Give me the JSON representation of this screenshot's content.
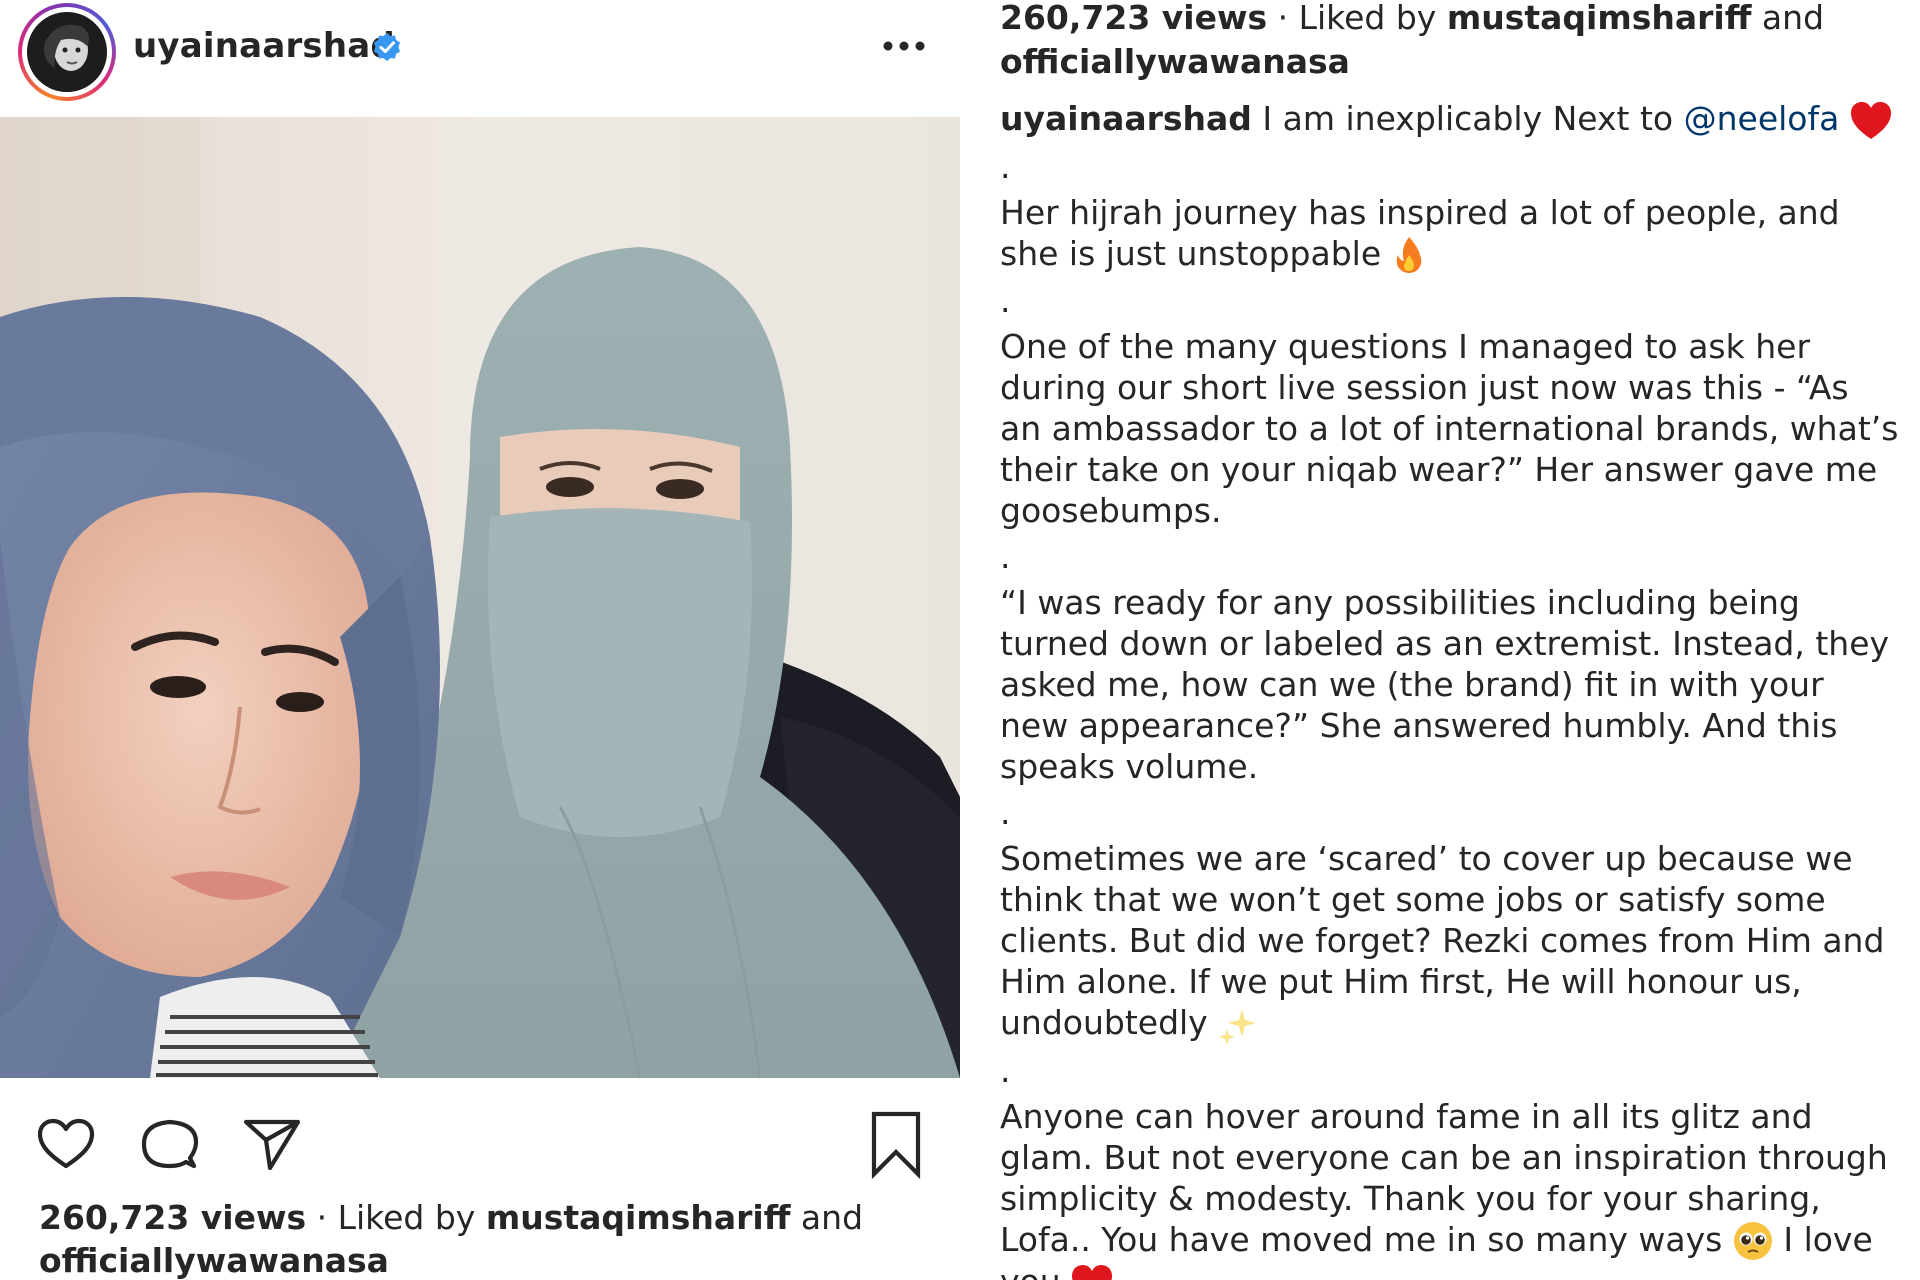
{
  "post": {
    "username": "uyainaarshad",
    "verified": true,
    "views": "260,723 views",
    "separator": " · ",
    "liked_by_prefix": "Liked by ",
    "liked_by_user": "mustaqimshariff",
    "liked_by_suffix": " and",
    "liked_by_second": "officiallywawanasa"
  },
  "icons": {
    "like": "heart-icon",
    "comment": "comment-bubble-icon",
    "share": "paper-plane-icon",
    "save": "bookmark-icon",
    "more": "more-dots-icon",
    "user_tag": "user-tag-icon",
    "verified": "verified-badge-icon"
  },
  "caption": {
    "author": "uyainaarshad",
    "intro": " I am inexplicably Next to ",
    "mention": "@neelofa",
    "dot": ".",
    "p1": "Her hijrah journey has inspired a lot of people, and she is just unstoppable",
    "p2": "One of the many questions I managed to ask her during our short live session just now was this - “As an ambassador to a lot of international brands, what’s their take on your niqab wear?” Her answer gave me goosebumps.",
    "p3": "“I was ready for any possibilities including being turned down or labeled as an extremist. Instead, they asked me, how can we (the brand) fit in with your new appearance?” She answered humbly. And this speaks volume.",
    "p4": "Sometimes we are ‘scared’ to cover up because we think that we won’t get some jobs or satisfy some clients. But did we forget? Rezki comes from Him and Him alone. If we put Him first, He will honour us, undoubtedly",
    "p5": "Anyone can hover around fame in all its glitz and glam. But not everyone can be an inspiration through simplicity & modesty. Thank you for your sharing, Lofa.. You have moved me in so many ways",
    "p5_end": " I love you"
  },
  "colors": {
    "text": "#262626",
    "mention": "#00376b",
    "verified": "#3897f0",
    "heart": "#e0161e",
    "hijab_blue": "#6f7fa3",
    "niqab_grey": "#9fb0b1"
  }
}
